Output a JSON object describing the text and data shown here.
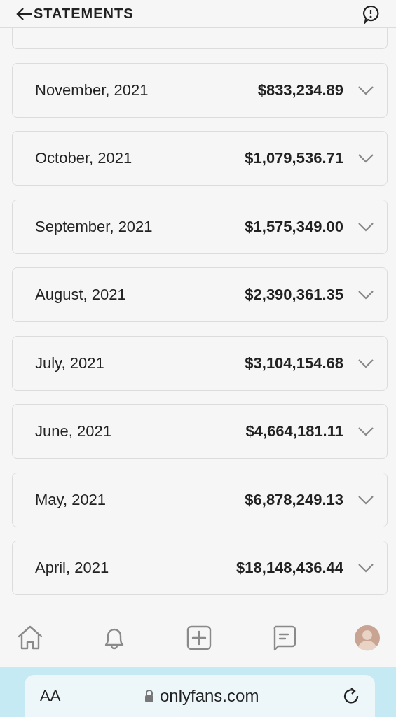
{
  "header": {
    "title": "STATEMENTS"
  },
  "statements": [
    {
      "month": "November, 2021",
      "amount": "$833,234.89",
      "expanded": false
    },
    {
      "month": "October, 2021",
      "amount": "$1,079,536.71",
      "expanded": false
    },
    {
      "month": "September, 2021",
      "amount": "$1,575,349.00",
      "expanded": false
    },
    {
      "month": "August, 2021",
      "amount": "$2,390,361.35",
      "expanded": false
    },
    {
      "month": "July, 2021",
      "amount": "$3,104,154.68",
      "expanded": false
    },
    {
      "month": "June, 2021",
      "amount": "$4,664,181.11",
      "expanded": false
    },
    {
      "month": "May, 2021",
      "amount": "$6,878,249.13",
      "expanded": false
    },
    {
      "month": "April, 2021",
      "amount": "$18,148,436.44",
      "expanded": false
    }
  ],
  "browser_bar": {
    "text_size": "AA",
    "url": "onlyfans.com"
  }
}
